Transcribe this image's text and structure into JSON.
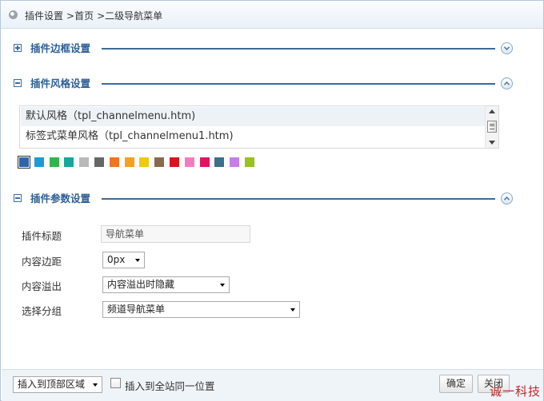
{
  "breadcrumb": {
    "items": [
      "插件设置",
      ">首页",
      ">二级导航菜单"
    ]
  },
  "sections": {
    "border": {
      "title": "插件边框设置"
    },
    "style": {
      "title": "插件风格设置"
    },
    "params": {
      "title": "插件参数设置"
    }
  },
  "style_list": {
    "items": [
      {
        "label": "默认风格（tpl_channelmenu.htm)"
      },
      {
        "label": "标签式菜单风格（tpl_channelmenu1.htm)"
      }
    ]
  },
  "colors": {
    "swatches": [
      "#2d66a8",
      "#1e9bd7",
      "#34b549",
      "#15a89a",
      "#b9b9b9",
      "#666666",
      "#f47320",
      "#f4a120",
      "#f2c80f",
      "#8a6a4a",
      "#d9141e",
      "#f27cc1",
      "#e3145f",
      "#3d6e8c",
      "#c77de8",
      "#98c21d"
    ]
  },
  "form": {
    "title_label": "插件标题",
    "title_value": "导航菜单",
    "padding_label": "内容边距",
    "padding_value": "0px",
    "overflow_label": "内容溢出",
    "overflow_value": "内容溢出时隐藏",
    "group_label": "选择分组",
    "group_value": "频道导航菜单"
  },
  "footer": {
    "region_value": "插入到顶部区域",
    "sitewide_label": "插入到全站同一位置",
    "confirm_label": "确定",
    "close_label": "关闭"
  },
  "watermark": "诚一科技"
}
